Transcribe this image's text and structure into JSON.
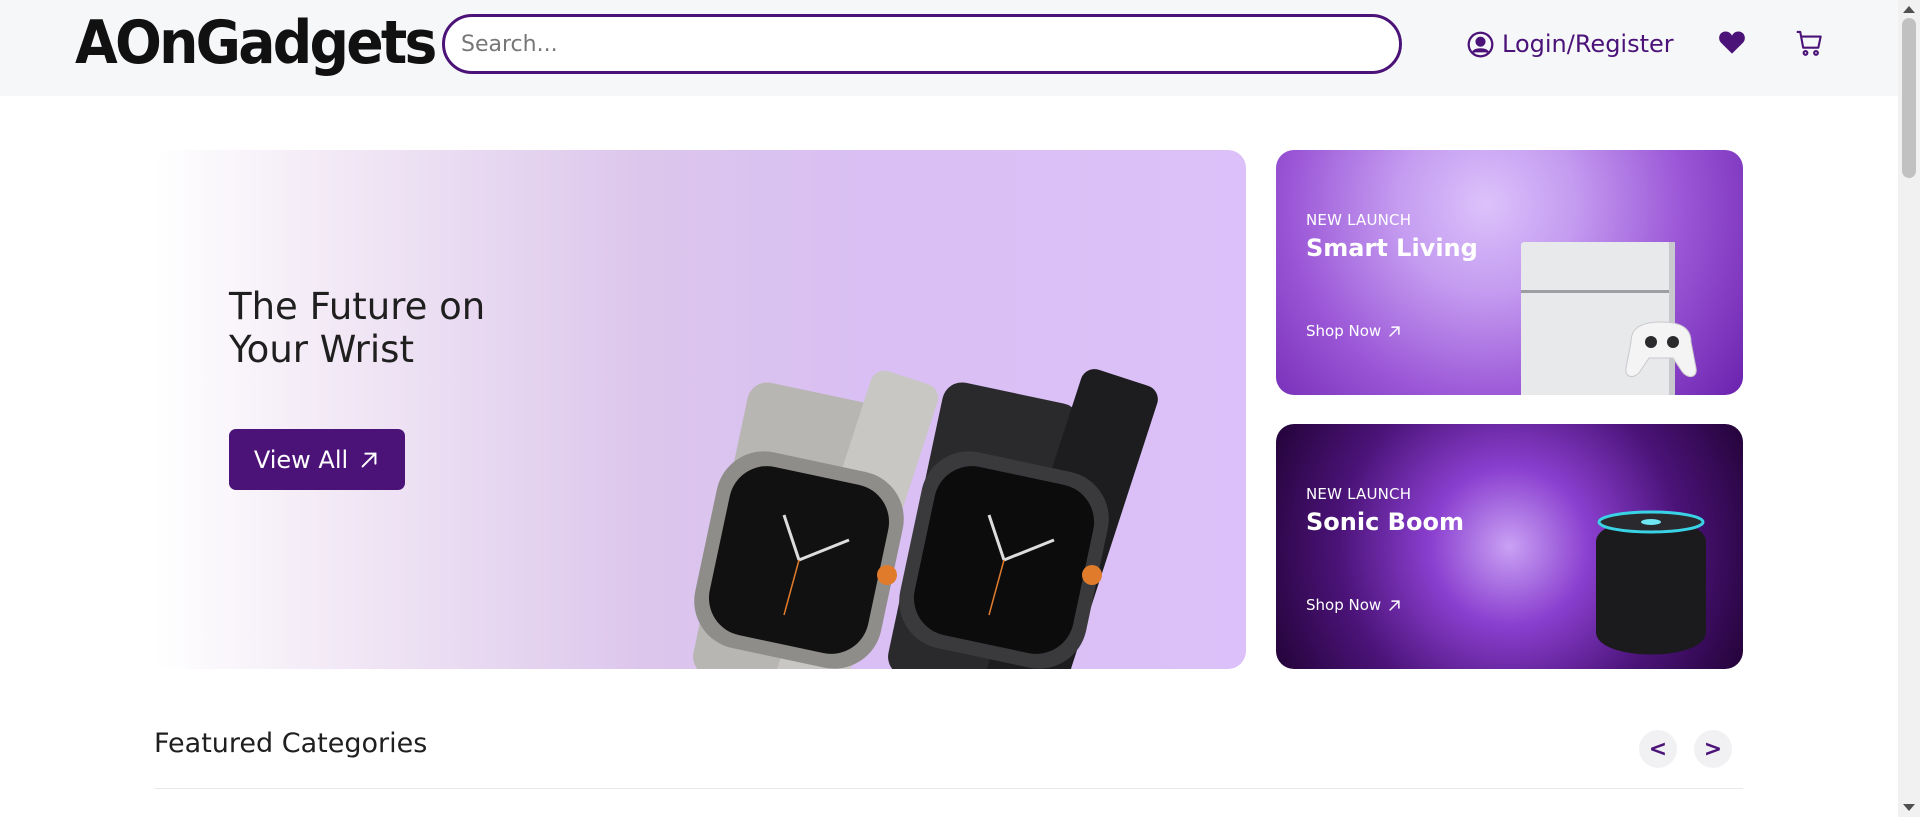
{
  "header": {
    "logo": "AOnGadgets",
    "search_placeholder": "Search...",
    "login_label": "Login/Register"
  },
  "hero": {
    "title": "The Future on Your Wrist",
    "button_label": "View All"
  },
  "promos": [
    {
      "tag": "NEW LAUNCH",
      "title": "Smart Living",
      "link": "Shop Now"
    },
    {
      "tag": "NEW LAUNCH",
      "title": "Sonic Boom",
      "link": "Shop Now"
    }
  ],
  "featured": {
    "title": "Featured Categories",
    "prev_label": "<",
    "next_label": ">"
  },
  "colors": {
    "brand": "#4b1378",
    "hero_bg": "#dcc0f9",
    "header_bg": "#f6f7f9"
  },
  "icons": [
    "user-circle-icon",
    "heart-icon",
    "cart-icon",
    "arrow-up-right-icon"
  ]
}
